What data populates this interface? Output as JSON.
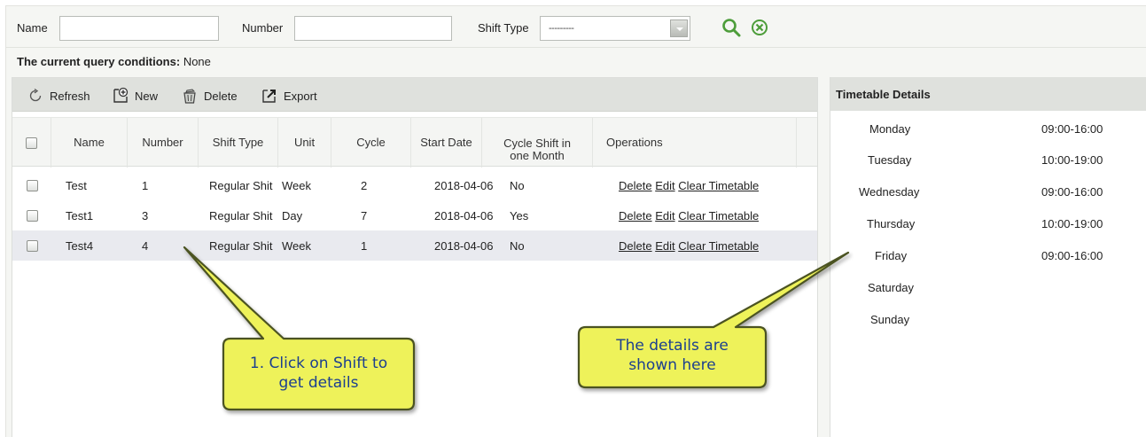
{
  "search": {
    "name_label": "Name",
    "name_value": "",
    "number_label": "Number",
    "number_value": "",
    "shift_type_label": "Shift Type",
    "shift_type_value": "---------",
    "search_icon": "search-icon",
    "clear_icon": "clear-icon"
  },
  "query": {
    "label": "The current query conditions:",
    "value": "None"
  },
  "toolbar": {
    "refresh": "Refresh",
    "new": "New",
    "delete": "Delete",
    "export": "Export"
  },
  "grid": {
    "columns": [
      "Name",
      "Number",
      "Shift Type",
      "Unit",
      "Cycle",
      "Start Date",
      "Cycle Shift in one Month",
      "Operations"
    ],
    "cycle_shift_line1": "Cycle Shift in",
    "cycle_shift_line2": "one Month",
    "rows": [
      {
        "name": "Test",
        "number": "1",
        "shift_type": "Regular Shit",
        "unit": "Week",
        "cycle": "2",
        "start_date": "2018-04-06",
        "cycle_shift": "No",
        "op_delete": "Delete",
        "op_edit": "Edit",
        "op_clear": "Clear Timetable"
      },
      {
        "name": "Test1",
        "number": "3",
        "shift_type": "Regular Shit",
        "unit": "Day",
        "cycle": "7",
        "start_date": "2018-04-06",
        "cycle_shift": "Yes",
        "op_delete": "Delete",
        "op_edit": "Edit",
        "op_clear": "Clear Timetable"
      },
      {
        "name": "Test4",
        "number": "4",
        "shift_type": "Regular Shit",
        "unit": "Week",
        "cycle": "1",
        "start_date": "2018-04-06",
        "cycle_shift": "No",
        "op_delete": "Delete",
        "op_edit": "Edit",
        "op_clear": "Clear Timetable"
      }
    ]
  },
  "timetable": {
    "title": "Timetable Details",
    "days": [
      {
        "day": "Monday",
        "time": "09:00-16:00"
      },
      {
        "day": "Tuesday",
        "time": "10:00-19:00"
      },
      {
        "day": "Wednesday",
        "time": "09:00-16:00"
      },
      {
        "day": "Thursday",
        "time": "10:00-19:00"
      },
      {
        "day": "Friday",
        "time": "09:00-16:00"
      },
      {
        "day": "Saturday",
        "time": ""
      },
      {
        "day": "Sunday",
        "time": ""
      }
    ]
  },
  "callouts": {
    "left_line1": "1. Click on Shift to",
    "left_line2": "get details",
    "right_line1": "The details are",
    "right_line2": "shown here"
  },
  "colors": {
    "accent_green": "#4d9d3a",
    "callout_fill": "#eef25a",
    "callout_text": "#1c3f8f",
    "selected_row": "#e9eaef",
    "toolbar_bg": "#dfe1dd"
  }
}
